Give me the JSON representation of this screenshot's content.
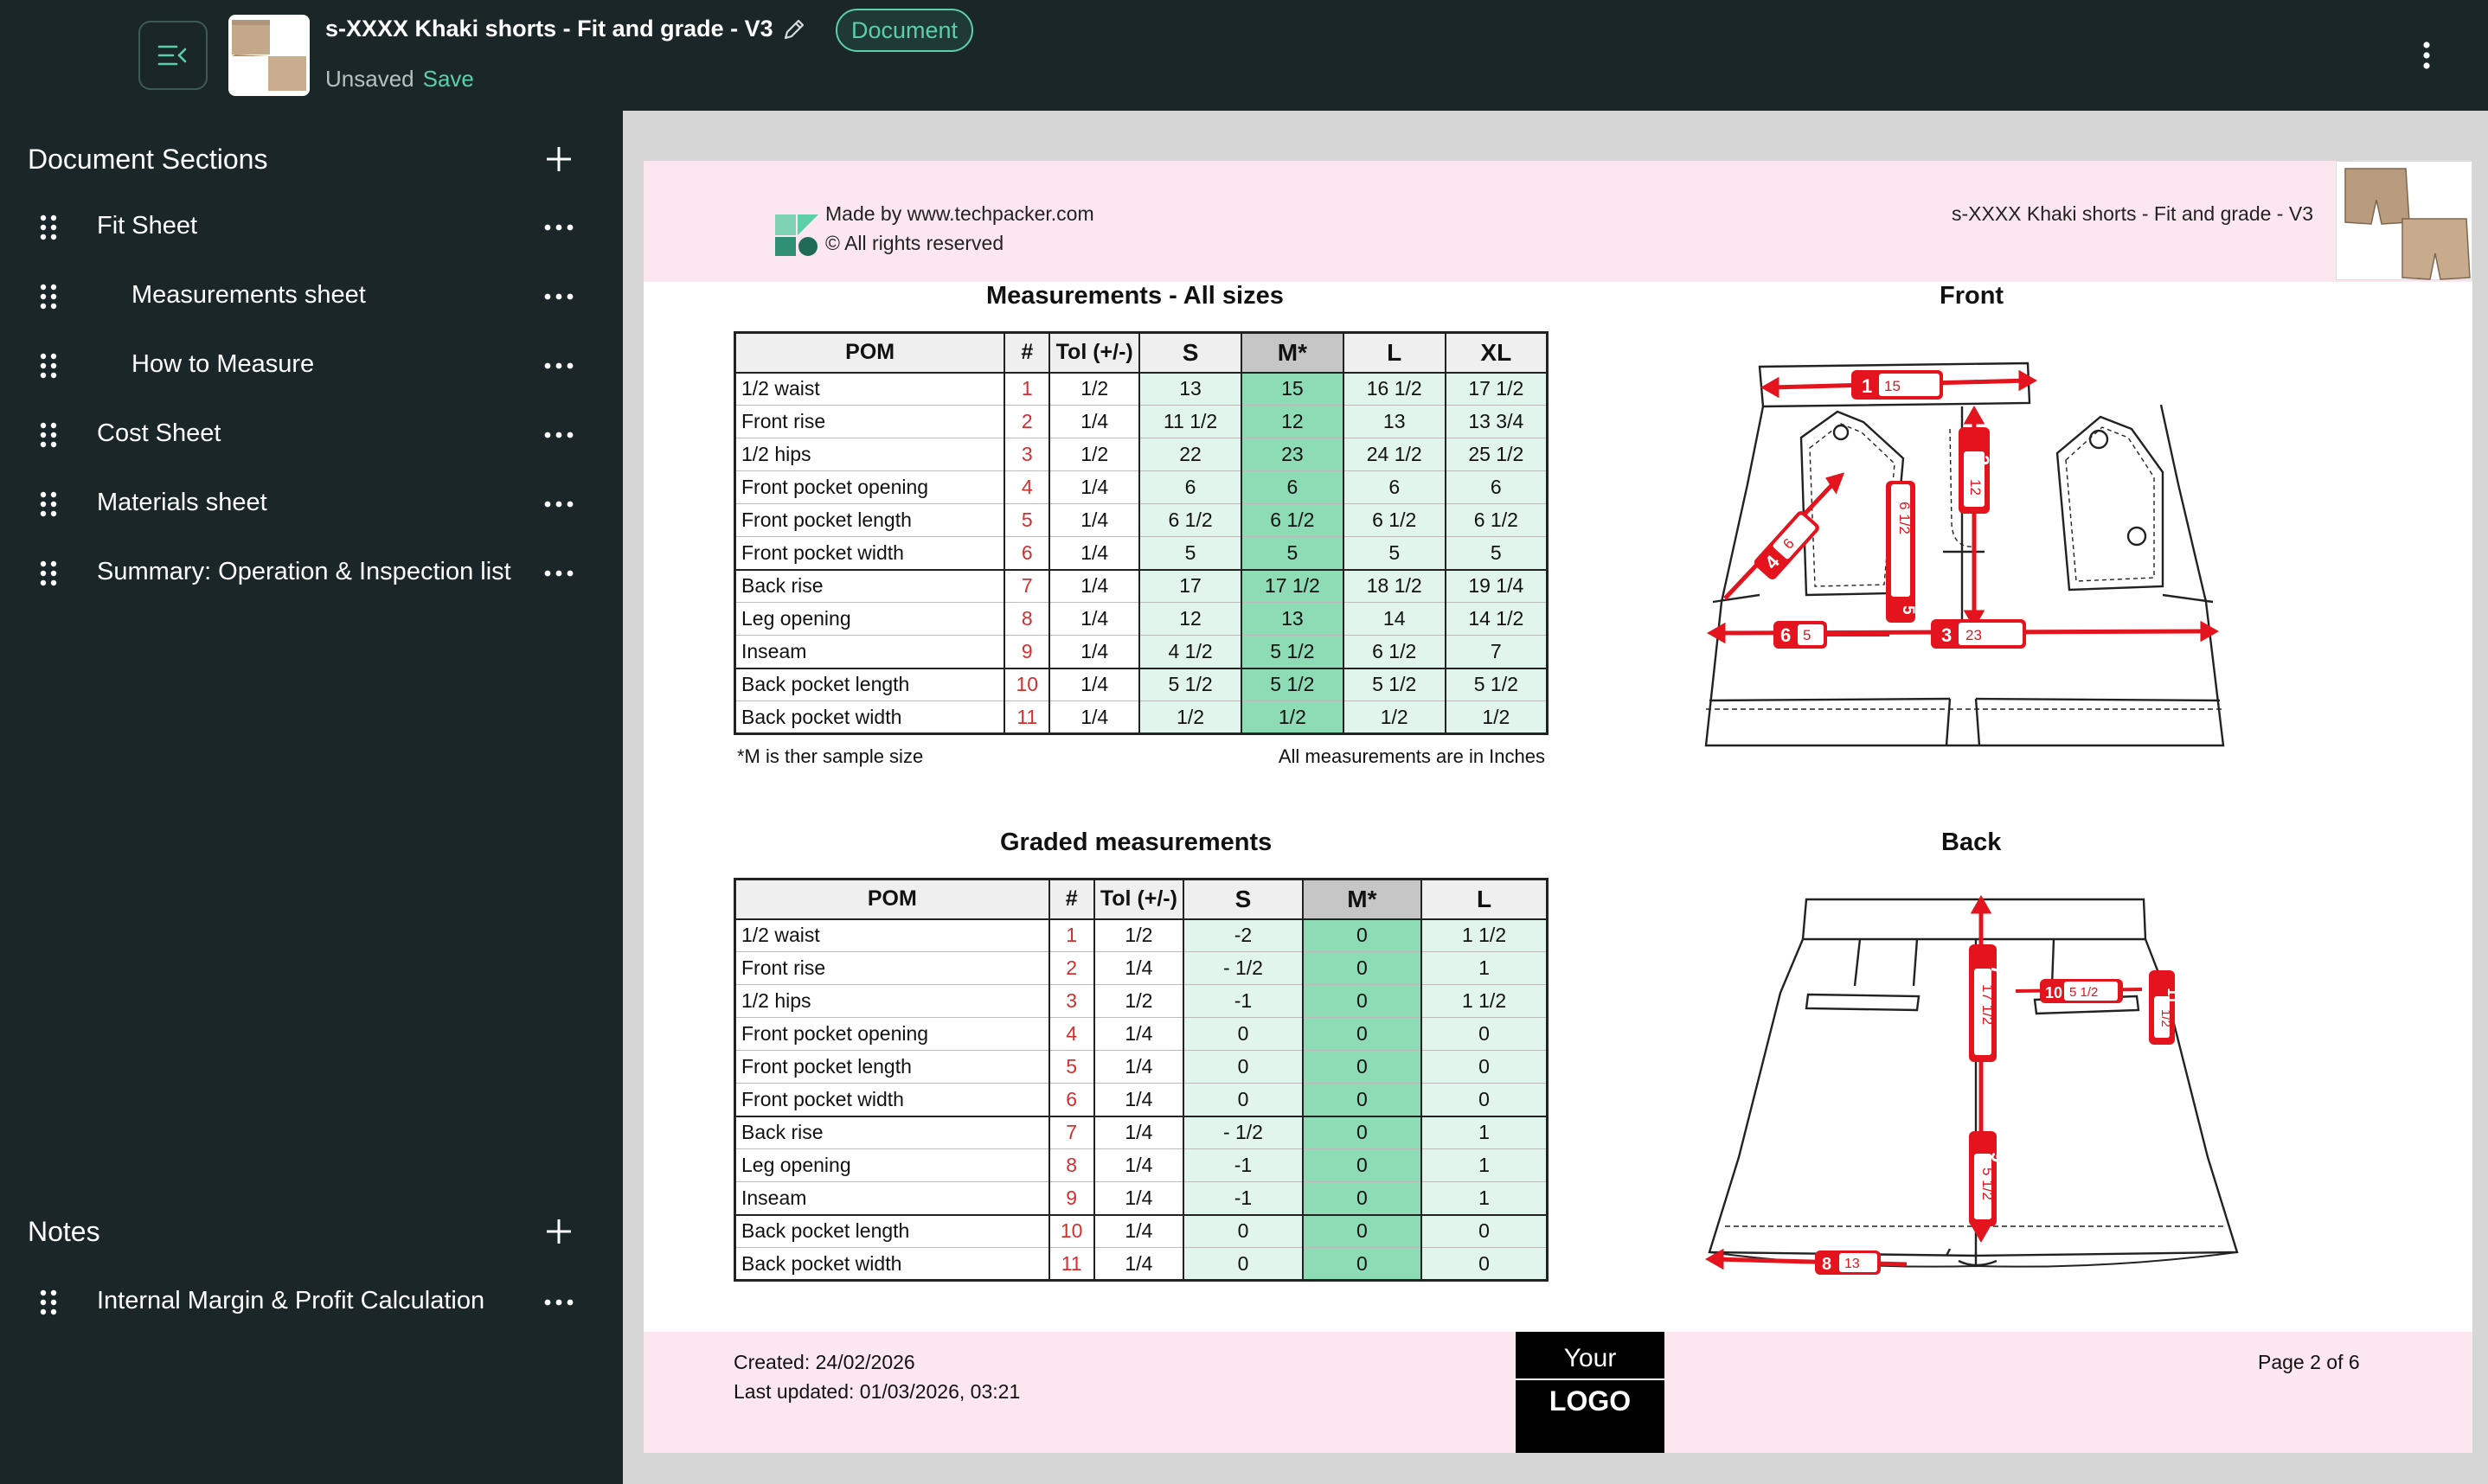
{
  "topbar": {
    "title": "s-XXXX Khaki shorts - Fit and grade - V3",
    "badge": "Document",
    "unsaved": "Unsaved",
    "save": "Save"
  },
  "sidebar": {
    "sections_title": "Document Sections",
    "items": [
      {
        "label": "Fit Sheet"
      },
      {
        "label": "Measurements sheet"
      },
      {
        "label": "How to Measure"
      },
      {
        "label": "Cost Sheet"
      },
      {
        "label": "Materials sheet"
      },
      {
        "label": "Summary: Operation & Inspection list"
      }
    ],
    "notes_title": "Notes",
    "notes": [
      {
        "label": "Internal Margin & Profit Calculation"
      }
    ]
  },
  "page": {
    "header": {
      "made_by": "Made by www.techpacker.com",
      "rights": "© All rights reserved",
      "doc_title": "s-XXXX Khaki shorts - Fit and grade - V3"
    },
    "table1": {
      "title": "Measurements - All sizes",
      "headers": [
        "POM",
        "#",
        "Tol (+/-)",
        "S",
        "M*",
        "L",
        "XL"
      ],
      "rows": [
        [
          "1/2 waist",
          "1",
          "1/2",
          "13",
          "15",
          "16 1/2",
          "17 1/2"
        ],
        [
          "Front rise",
          "2",
          "1/4",
          "11 1/2",
          "12",
          "13",
          "13 3/4"
        ],
        [
          "1/2 hips",
          "3",
          "1/2",
          "22",
          "23",
          "24 1/2",
          "25 1/2"
        ],
        [
          "Front pocket opening",
          "4",
          "1/4",
          "6",
          "6",
          "6",
          "6"
        ],
        [
          "Front pocket length",
          "5",
          "1/4",
          "6 1/2",
          "6 1/2",
          "6 1/2",
          "6 1/2"
        ],
        [
          "Front pocket width",
          "6",
          "1/4",
          "5",
          "5",
          "5",
          "5"
        ],
        [
          "Back rise",
          "7",
          "1/4",
          "17",
          "17 1/2",
          "18 1/2",
          "19 1/4"
        ],
        [
          "Leg opening",
          "8",
          "1/4",
          "12",
          "13",
          "14",
          "14 1/2"
        ],
        [
          "Inseam",
          "9",
          "1/4",
          "4 1/2",
          "5 1/2",
          "6 1/2",
          "7"
        ],
        [
          "Back pocket length",
          "10",
          "1/4",
          "5 1/2",
          "5 1/2",
          "5 1/2",
          "5 1/2"
        ],
        [
          "Back pocket width",
          "11",
          "1/4",
          "1/2",
          "1/2",
          "1/2",
          "1/2"
        ]
      ],
      "note_left": "*M is ther sample size",
      "note_right": "All measurements are in Inches"
    },
    "table2": {
      "title": "Graded measurements",
      "headers": [
        "POM",
        "#",
        "Tol (+/-)",
        "S",
        "M*",
        "L"
      ],
      "rows": [
        [
          "1/2 waist",
          "1",
          "1/2",
          "-2",
          "0",
          "1 1/2"
        ],
        [
          "Front rise",
          "2",
          "1/4",
          "- 1/2",
          "0",
          "1"
        ],
        [
          "1/2 hips",
          "3",
          "1/2",
          "-1",
          "0",
          "1 1/2"
        ],
        [
          "Front pocket opening",
          "4",
          "1/4",
          "0",
          "0",
          "0"
        ],
        [
          "Front pocket length",
          "5",
          "1/4",
          "0",
          "0",
          "0"
        ],
        [
          "Front pocket width",
          "6",
          "1/4",
          "0",
          "0",
          "0"
        ],
        [
          "Back rise",
          "7",
          "1/4",
          "- 1/2",
          "0",
          "1"
        ],
        [
          "Leg opening",
          "8",
          "1/4",
          "-1",
          "0",
          "1"
        ],
        [
          "Inseam",
          "9",
          "1/4",
          "-1",
          "0",
          "1"
        ],
        [
          "Back pocket length",
          "10",
          "1/4",
          "0",
          "0",
          "0"
        ],
        [
          "Back pocket width",
          "11",
          "1/4",
          "0",
          "0",
          "0"
        ]
      ]
    },
    "front": {
      "title": "Front",
      "labels": {
        "waist": "1",
        "waist_val": "15",
        "rise": "2",
        "rise_val": "12",
        "hips": "3",
        "hips_val": "23",
        "opening": "4",
        "opening_val": "6",
        "length": "5",
        "length_val": "6 1/2",
        "width": "6",
        "width_val": "5"
      }
    },
    "back": {
      "title": "Back",
      "labels": {
        "rise": "7",
        "rise_val": "17 1/2",
        "inseam": "9",
        "inseam_val": "5 1/2",
        "leg": "8",
        "leg_val": "13",
        "pocket_len": "10",
        "pocket_len_val": "5 1/2",
        "pocket_w": "11",
        "pocket_w_val": "1/2"
      }
    },
    "footer": {
      "created": "Created: 24/02/2026",
      "updated": "Last updated: 01/03/2026, 03:21",
      "logo_top": "Your",
      "logo_bottom": "LOGO",
      "page": "Page 2 of 6"
    }
  },
  "colors": {
    "accent": "#5ccfa8",
    "sidebar": "#1a2628",
    "measure_red": "#e3141d",
    "sample_col": "#8edcb6",
    "size_col": "#e1f5ec",
    "pink": "#fce7f1"
  }
}
